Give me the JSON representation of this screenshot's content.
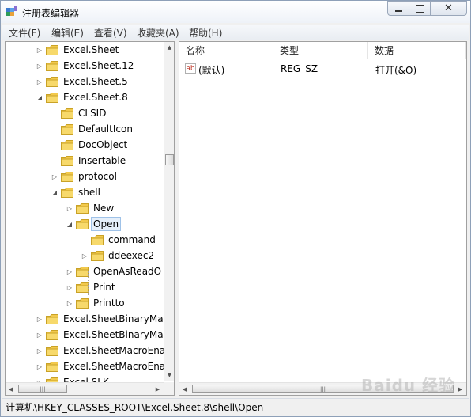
{
  "window": {
    "title": "注册表编辑器"
  },
  "menu": [
    {
      "label": "文件(F)"
    },
    {
      "label": "编辑(E)"
    },
    {
      "label": "查看(V)"
    },
    {
      "label": "收藏夹(A)"
    },
    {
      "label": "帮助(H)"
    }
  ],
  "tree": {
    "items": [
      {
        "label": "Excel.Sheet",
        "expander": "▷"
      },
      {
        "label": "Excel.Sheet.12",
        "expander": "▷"
      },
      {
        "label": "Excel.Sheet.5",
        "expander": "▷"
      },
      {
        "label": "Excel.Sheet.8",
        "expander": "◢"
      },
      {
        "label": "CLSID",
        "expander": ""
      },
      {
        "label": "DefaultIcon",
        "expander": ""
      },
      {
        "label": "DocObject",
        "expander": ""
      },
      {
        "label": "Insertable",
        "expander": ""
      },
      {
        "label": "protocol",
        "expander": "▷"
      },
      {
        "label": "shell",
        "expander": "◢"
      },
      {
        "label": "New",
        "expander": "▷"
      },
      {
        "label": "Open",
        "expander": "◢"
      },
      {
        "label": "command",
        "expander": ""
      },
      {
        "label": "ddeexec2",
        "expander": "▷"
      },
      {
        "label": "OpenAsReadO",
        "expander": "▷"
      },
      {
        "label": "Print",
        "expander": "▷"
      },
      {
        "label": "Printto",
        "expander": "▷"
      },
      {
        "label": "Excel.SheetBinaryMac",
        "expander": "▷"
      },
      {
        "label": "Excel.SheetBinaryMac",
        "expander": "▷"
      },
      {
        "label": "Excel.SheetMacroEna",
        "expander": "▷"
      },
      {
        "label": "Excel.SheetMacroEna",
        "expander": "▷"
      },
      {
        "label": "Excel.SLK",
        "expander": "▷"
      }
    ],
    "selected_label": "Open"
  },
  "list": {
    "columns": [
      "名称",
      "类型",
      "数据"
    ],
    "rows": [
      {
        "name": "(默认)",
        "type": "REG_SZ",
        "data": "打开(&O)",
        "icon": "ab-string-icon",
        "icon_text": "ab"
      }
    ]
  },
  "status": {
    "path": "计算机\\HKEY_CLASSES_ROOT\\Excel.Sheet.8\\shell\\Open"
  },
  "watermark": {
    "text": "Baidu 经验"
  },
  "colors": {
    "folder": "#f2c94c",
    "selection": "#e5effa",
    "accent": "#3a6ea5"
  }
}
